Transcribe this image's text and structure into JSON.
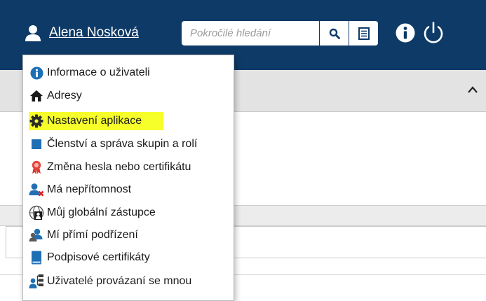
{
  "header": {
    "user_name": "Alena Nosková",
    "search_placeholder": "Pokročilé hledání",
    "colors": {
      "bar": "#0e3a67",
      "text": "#ffffff"
    }
  },
  "user_menu": {
    "items": [
      {
        "label": "Informace o uživateli",
        "icon": "info-circle-icon"
      },
      {
        "label": "Adresy",
        "icon": "home-icon"
      },
      {
        "label": "Nastavení aplikace",
        "icon": "gear-icon",
        "highlighted": true
      },
      {
        "label": "Členství a správa skupin a rolí",
        "icon": "square-icon"
      },
      {
        "label": "Změna hesla nebo certifikátu",
        "icon": "ribbon-icon"
      },
      {
        "label": "Má nepřítomnost",
        "icon": "user-absent-icon"
      },
      {
        "label": "Můj globální zástupce",
        "icon": "global-deputy-icon"
      },
      {
        "label": "Mí přímí podřízení",
        "icon": "subordinates-icon"
      },
      {
        "label": "Podpisové certifikáty",
        "icon": "book-icon"
      },
      {
        "label": "Uživatelé provázaní se mnou",
        "icon": "linked-users-icon"
      }
    ],
    "highlight_color": "#f6ff2a"
  }
}
